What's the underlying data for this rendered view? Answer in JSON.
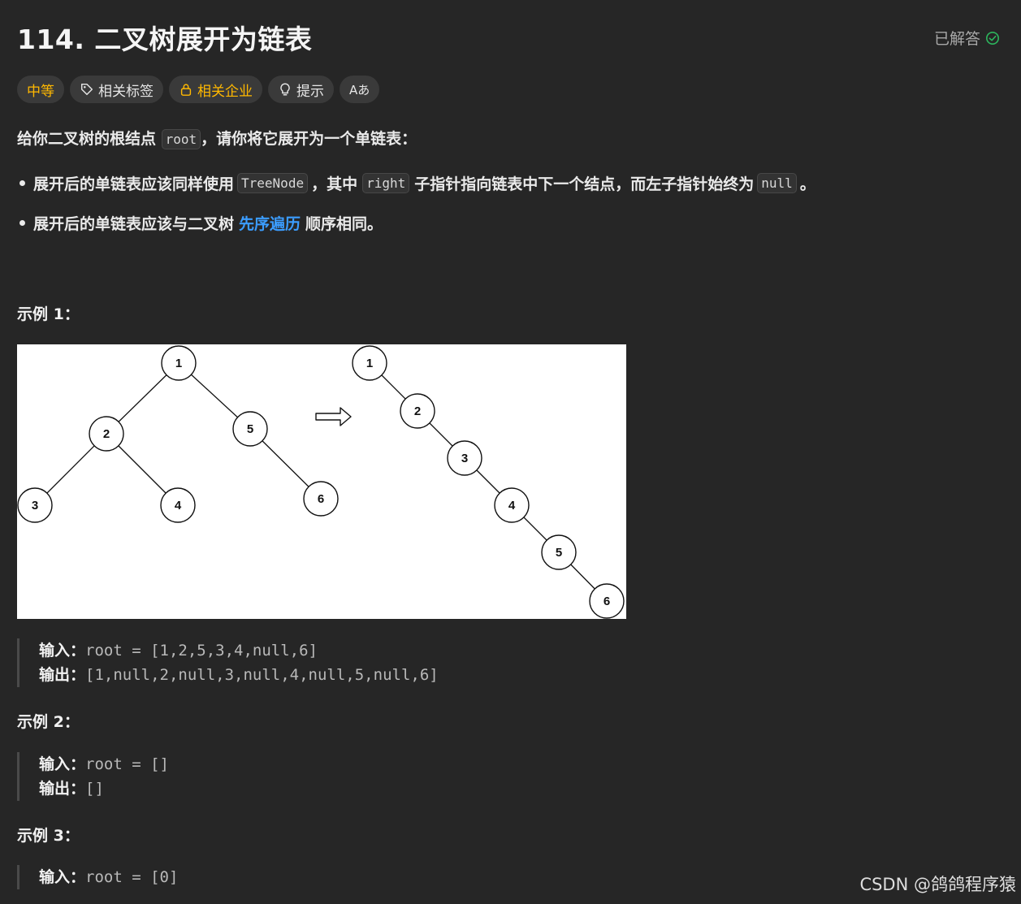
{
  "problem": {
    "title": "114. 二叉树展开为链表",
    "status": "已解答"
  },
  "tags": {
    "difficulty": "中等",
    "related_tags": "相关标签",
    "related_companies": "相关企业",
    "hint": "提示",
    "translate": "Aあ"
  },
  "description": {
    "intro_pre": "给你二叉树的根结点",
    "intro_code": "root",
    "intro_post": "，请你将它展开为一个单链表：",
    "b1_pre": "展开后的单链表应该同样使用",
    "b1_code1": "TreeNode",
    "b1_mid": "，其中",
    "b1_code2": "right",
    "b1_mid2": "子指针指向链表中下一个结点，而左子指针始终为",
    "b1_code3": "null",
    "b1_post": "。",
    "b2_pre": "展开后的单链表应该与二叉树",
    "b2_link": "先序遍历",
    "b2_post": "顺序相同。"
  },
  "examples": [
    {
      "heading": "示例 1：",
      "input_label": "输入：",
      "input": "root = [1,2,5,3,4,null,6]",
      "output_label": "输出：",
      "output": "[1,null,2,null,3,null,4,null,5,null,6]"
    },
    {
      "heading": "示例 2：",
      "input_label": "输入：",
      "input": "root = []",
      "output_label": "输出：",
      "output": "[]"
    },
    {
      "heading": "示例 3：",
      "input_label": "输入：",
      "input": "root = [0]"
    }
  ],
  "figure": {
    "tree_nodes": [
      "1",
      "2",
      "5",
      "3",
      "4",
      "6"
    ],
    "list_nodes": [
      "1",
      "2",
      "3",
      "4",
      "5",
      "6"
    ]
  },
  "watermark": "CSDN @鸽鸽程序猿",
  "colors": {
    "background": "#262626",
    "difficulty": "#ffb800",
    "link": "#3b9dff",
    "solved_check": "#2db55d"
  }
}
